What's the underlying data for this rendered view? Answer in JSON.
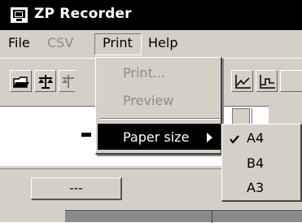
{
  "window": {
    "title": "ZP Recorder",
    "icon": "monitor-icon"
  },
  "menubar": {
    "items": [
      {
        "label": "File",
        "enabled": true
      },
      {
        "label": "CSV",
        "enabled": false
      },
      {
        "label": "Print",
        "enabled": true,
        "open": true
      },
      {
        "label": "Help",
        "enabled": true
      }
    ]
  },
  "toolbar": {
    "buttons": [
      {
        "icon": "open-folder-icon"
      },
      {
        "icon": "scale-icon"
      },
      {
        "icon": "scale-disabled-icon"
      },
      {
        "icon": "line-chart-icon"
      },
      {
        "icon": "step-chart-icon"
      }
    ]
  },
  "print_menu": {
    "items": [
      {
        "label": "Print...",
        "enabled": false
      },
      {
        "label": "Preview",
        "enabled": false
      },
      {
        "label": "Paper size",
        "enabled": true,
        "highlighted": true,
        "has_submenu": true
      }
    ]
  },
  "paper_size_submenu": {
    "items": [
      {
        "label": "A4",
        "checked": true
      },
      {
        "label": "B4",
        "checked": false
      },
      {
        "label": "A3",
        "checked": false
      }
    ]
  },
  "content": {
    "field_value": "---"
  },
  "colors": {
    "chrome": "#d4d0c8",
    "titlebar": "#000000",
    "highlight": "#000000",
    "disabled_text": "#8c8c8c"
  }
}
